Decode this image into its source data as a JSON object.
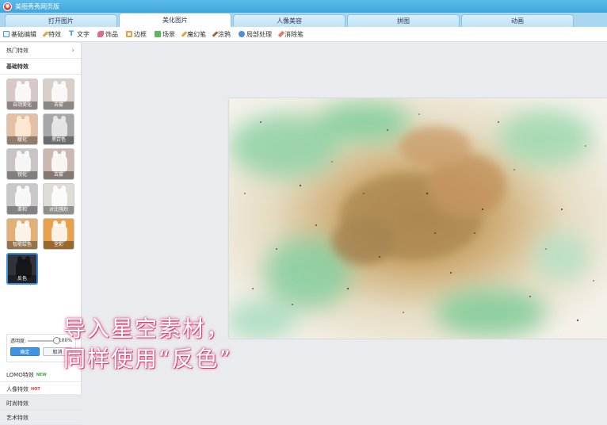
{
  "window": {
    "title": "美图秀秀网页版"
  },
  "tabs": [
    {
      "label": "打开图片",
      "active": false
    },
    {
      "label": "美化图片",
      "active": true
    },
    {
      "label": "人像美容",
      "active": false
    },
    {
      "label": "拼图",
      "active": false
    },
    {
      "label": "动画",
      "active": false
    }
  ],
  "toolbar": [
    {
      "label": "基础编辑",
      "icon": "edit-icon",
      "color": "#4a90d9"
    },
    {
      "label": "特效",
      "icon": "wand-icon",
      "color": "#e0a43a"
    },
    {
      "label": "文字",
      "icon": "text-icon",
      "color": "#3aa0d8"
    },
    {
      "label": "饰品",
      "icon": "bow-icon",
      "color": "#e46a8a"
    },
    {
      "label": "边框",
      "icon": "frame-icon",
      "color": "#e6a23c"
    },
    {
      "label": "场景",
      "icon": "scene-icon",
      "color": "#5bb55b"
    },
    {
      "label": "魔幻笔",
      "icon": "magic-pen-icon",
      "color": "#e0a43a"
    },
    {
      "label": "涂鸦",
      "icon": "brush-icon",
      "color": "#a0663a"
    },
    {
      "label": "局部处理",
      "icon": "partial-icon",
      "color": "#4a90d9"
    },
    {
      "label": "消除笔",
      "icon": "eraser-icon",
      "color": "#e07a6a"
    }
  ],
  "sidebar": {
    "hot_section": "热门特效",
    "basic_section": "基础特效",
    "effects": [
      {
        "label": "自动美化",
        "tint": "#d9c9c6"
      },
      {
        "label": "去雾",
        "tint": "#d8cfc9"
      },
      {
        "label": "暖化",
        "tint": "#e4bfa4"
      },
      {
        "label": "黑白色",
        "tint": "#a7a7a7"
      },
      {
        "label": "锐化",
        "tint": "#c9c4c4"
      },
      {
        "label": "去雾",
        "tint": "#cdb8b0"
      },
      {
        "label": "柔和",
        "tint": "#c9c7c9"
      },
      {
        "label": "对比强烈",
        "tint": "#dedcd4"
      },
      {
        "label": "智能绘色",
        "tint": "#e2b074"
      },
      {
        "label": "全彩",
        "tint": "#e8a24c"
      },
      {
        "label": "反色",
        "tint": "#30343a"
      }
    ],
    "opacity_label": "透明度:",
    "opacity_value": "100%",
    "opacity_fraction": 1.0,
    "confirm_label": "确定",
    "cancel_label": "取消",
    "lomo_section": "LOMO特效",
    "lomo_badge": "NEW",
    "portrait_section": "人像特效",
    "portrait_badge": "HOT",
    "fashion_section": "时尚特效",
    "art_section": "艺术特效"
  },
  "caption": {
    "line1": "导入星空素材，",
    "line2": "同样使用“反色”"
  },
  "colors": {
    "title_bar": "#3ea6dc",
    "accent": "#3e93e3",
    "new_badge": "#44aa44",
    "hot_badge": "#e03a3a"
  }
}
